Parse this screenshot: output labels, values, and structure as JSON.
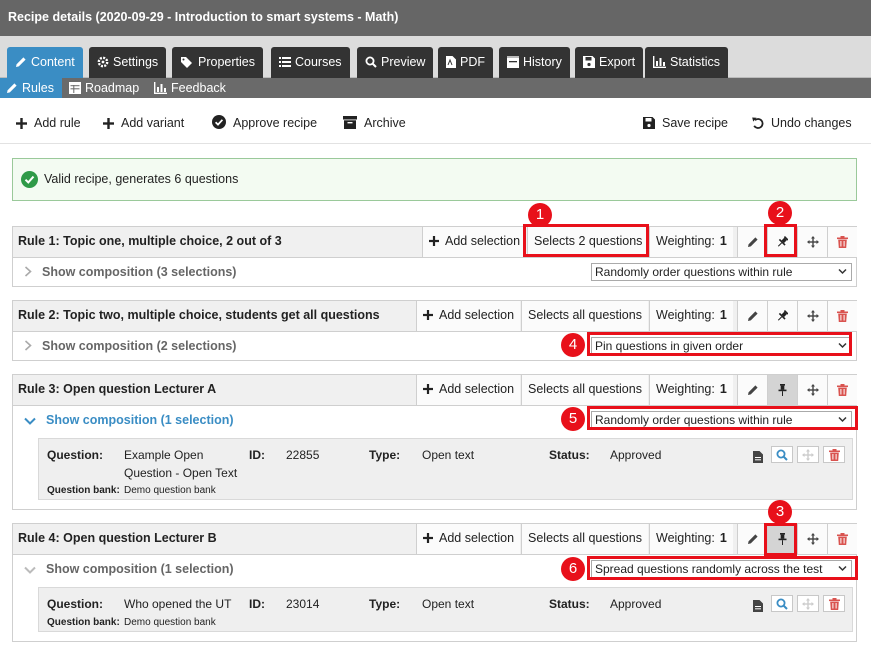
{
  "window": {
    "title": "Recipe details  (2020-09-29 - Introduction to smart systems - Math)"
  },
  "tabs": [
    {
      "label": "Content",
      "icon": "pencil-icon"
    },
    {
      "label": "Settings",
      "icon": "gear-icon"
    },
    {
      "label": "Properties",
      "icon": "tags-icon"
    },
    {
      "label": "Courses",
      "icon": "list-icon"
    },
    {
      "label": "Preview",
      "icon": "search-icon"
    },
    {
      "label": "PDF",
      "icon": "pdf-icon"
    },
    {
      "label": "History",
      "icon": "history-icon"
    },
    {
      "label": "Export",
      "icon": "save-icon"
    },
    {
      "label": "Statistics",
      "icon": "chart-icon"
    }
  ],
  "subtabs": [
    {
      "label": "Rules",
      "icon": "pencil-icon"
    },
    {
      "label": "Roadmap",
      "icon": "table-icon"
    },
    {
      "label": "Feedback",
      "icon": "chart-icon"
    }
  ],
  "toolbar": {
    "add_rule": "Add rule",
    "add_variant": "Add variant",
    "approve": "Approve recipe",
    "archive": "Archive",
    "save": "Save recipe",
    "undo": "Undo changes"
  },
  "validation": {
    "message": "Valid recipe, generates 6 questions"
  },
  "rules": [
    {
      "title": "Rule 1: Topic one, multiple choice, 2 out of 3",
      "add_selection": "Add selection",
      "selects": "Selects 2 questions",
      "weighting_label": "Weighting:",
      "weighting": "1",
      "composition": "Show composition (3 selections)",
      "order": "Randomly order questions within rule"
    },
    {
      "title": "Rule 2: Topic two, multiple choice, students get all questions",
      "add_selection": "Add selection",
      "selects": "Selects all questions",
      "weighting_label": "Weighting:",
      "weighting": "1",
      "composition": "Show composition (2 selections)",
      "order": "Pin questions in given order"
    },
    {
      "title": "Rule 3: Open question Lecturer A",
      "add_selection": "Add selection",
      "selects": "Selects all questions",
      "weighting_label": "Weighting:",
      "weighting": "1",
      "composition": "Show composition (1 selection)",
      "order": "Randomly order questions within rule",
      "question": {
        "q_label": "Question:",
        "q_text1": "Example Open",
        "q_text2": "Question - Open Text",
        "id_label": "ID:",
        "id": "22855",
        "type_label": "Type:",
        "type": "Open text",
        "status_label": "Status:",
        "status": "Approved",
        "bank_label": "Question bank:",
        "bank": "Demo question bank"
      }
    },
    {
      "title": "Rule 4: Open question Lecturer B",
      "add_selection": "Add selection",
      "selects": "Selects all questions",
      "weighting_label": "Weighting:",
      "weighting": "1",
      "composition": "Show composition (1 selection)",
      "order": "Spread questions randomly across the test",
      "question": {
        "q_label": "Question:",
        "q_text1": "Who opened the UT",
        "id_label": "ID:",
        "id": "23014",
        "type_label": "Type:",
        "type": "Open text",
        "status_label": "Status:",
        "status": "Approved",
        "bank_label": "Question bank:",
        "bank": "Demo question bank"
      }
    }
  ],
  "annotations": [
    "1",
    "2",
    "3",
    "4",
    "5",
    "6"
  ],
  "colors": {
    "accent": "#3a8dc4",
    "highlight": "#e8101a",
    "success": "#2e9a48",
    "danger": "#d9534f"
  }
}
